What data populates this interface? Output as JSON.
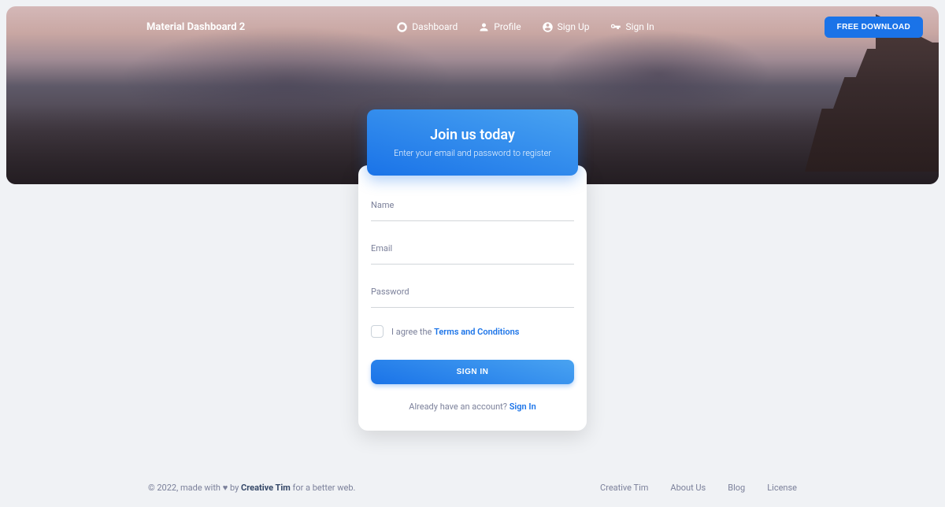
{
  "brand": "Material Dashboard 2",
  "nav": {
    "dashboard": "Dashboard",
    "profile": "Profile",
    "signup": "Sign Up",
    "signin": "Sign In"
  },
  "download_label": "FREE DOWNLOAD",
  "card": {
    "title": "Join us today",
    "subtitle": "Enter your email and password to register",
    "name_label": "Name",
    "email_label": "Email",
    "password_label": "Password",
    "agree_prefix": "I agree the ",
    "agree_link": "Terms and Conditions",
    "submit": "SIGN IN",
    "already_prefix": "Already have an account? ",
    "already_link": "Sign In"
  },
  "footer": {
    "copyright_prefix": "© 2022, made with ",
    "by": " by ",
    "author": "Creative Tim",
    "suffix": " for a better web.",
    "links": {
      "creative_tim": "Creative Tim",
      "about": "About Us",
      "blog": "Blog",
      "license": "License"
    }
  }
}
